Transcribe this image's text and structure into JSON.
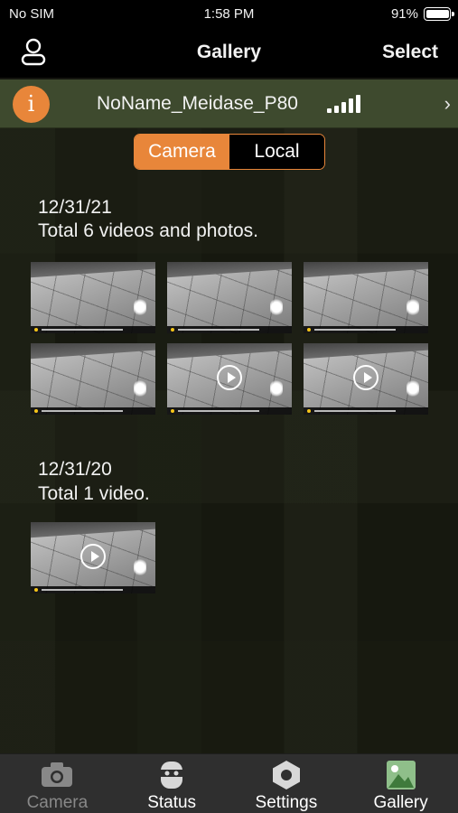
{
  "status_bar": {
    "carrier": "No SIM",
    "time": "1:58 PM",
    "battery": "91%"
  },
  "nav": {
    "title": "Gallery",
    "select_label": "Select",
    "user_icon": "user-icon"
  },
  "device": {
    "info_glyph": "i",
    "name": "NoName_Meidase_P80",
    "signal_bars": 5
  },
  "segment": {
    "camera_label": "Camera",
    "local_label": "Local",
    "selected": "Camera"
  },
  "groups": [
    {
      "date": "12/31/21",
      "total": "Total 6 videos and photos.",
      "items": [
        {
          "type": "photo"
        },
        {
          "type": "photo"
        },
        {
          "type": "photo"
        },
        {
          "type": "photo"
        },
        {
          "type": "video"
        },
        {
          "type": "video"
        }
      ]
    },
    {
      "date": "12/31/20",
      "total": "Total 1 video.",
      "items": [
        {
          "type": "video"
        }
      ]
    }
  ],
  "tabs": [
    {
      "label": "Camera",
      "icon": "camera-icon",
      "active": false
    },
    {
      "label": "Status",
      "icon": "status-icon",
      "active": false
    },
    {
      "label": "Settings",
      "icon": "settings-icon",
      "active": false
    },
    {
      "label": "Gallery",
      "icon": "gallery-icon",
      "active": true
    }
  ],
  "colors": {
    "accent": "#e8863a",
    "device_bar": "#3e4a2e",
    "tab_bar": "#2f2f2f"
  }
}
